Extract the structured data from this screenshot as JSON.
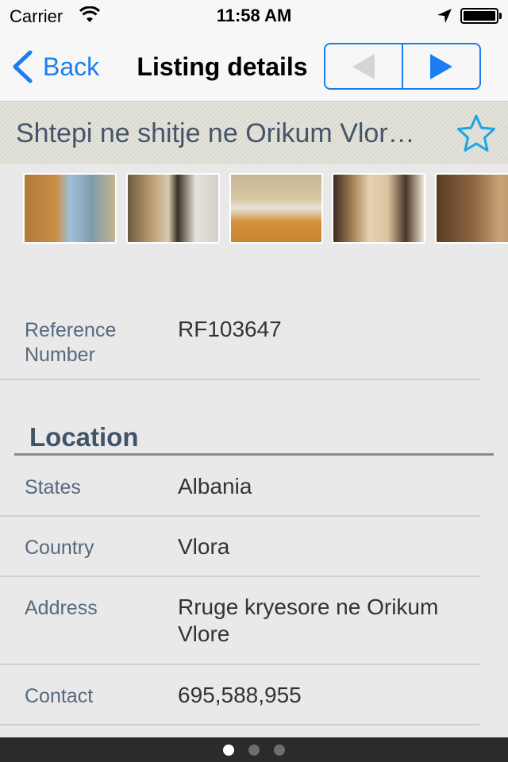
{
  "status_bar": {
    "carrier": "Carrier",
    "time": "11:58 AM"
  },
  "nav": {
    "back_label": "Back",
    "title": "Listing details",
    "accent_color": "#1a7ef0",
    "prev_enabled": false,
    "next_enabled": true
  },
  "listing": {
    "title": "Shtepi ne shitje ne Orikum Vlor…",
    "favorite": false,
    "photo_count_visible": 5
  },
  "details": {
    "reference": {
      "label": "Reference Number",
      "value": "RF103647"
    }
  },
  "location": {
    "heading": "Location",
    "rows": [
      {
        "label": "States",
        "value": "Albania"
      },
      {
        "label": "Country",
        "value": "Vlora"
      },
      {
        "label": "Address",
        "value": "Rruge kryesore ne Orikum Vlore"
      },
      {
        "label": "Contact",
        "value": "695,588,955"
      }
    ]
  },
  "page_control": {
    "pages": 3,
    "current": 1
  }
}
